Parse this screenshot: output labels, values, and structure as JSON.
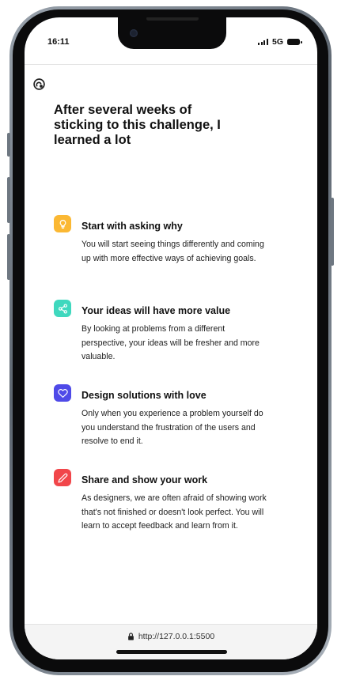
{
  "status_bar": {
    "time": "16:11",
    "network": "5G"
  },
  "page": {
    "headline": "After several weeks of sticking to this challenge, I learned a lot",
    "features": [
      {
        "title": "Start with asking why",
        "description": "You will start seeing things differently and coming up with more effective ways of achieving goals.",
        "icon": "lightbulb-icon",
        "color": "#FBB833"
      },
      {
        "title": "Your ideas will have more value",
        "description": "By looking at problems from a different perspective, your ideas will be fresher and more valuable.",
        "icon": "share-icon",
        "color": "#3FD8BE"
      },
      {
        "title": "Design solutions with love",
        "description": "Only when you experience a problem yourself do you understand the frustration of the users and resolve to end it.",
        "icon": "heart-icon",
        "color": "#4F4AE8"
      },
      {
        "title": "Share and show your work",
        "description": "As designers, we are often afraid of showing work that's not finished or doesn't look perfect. You will learn to accept feedback and learn from it.",
        "icon": "pencil-icon",
        "color": "#F1464A"
      }
    ]
  },
  "browser": {
    "url": "http://127.0.0.1:5500"
  }
}
